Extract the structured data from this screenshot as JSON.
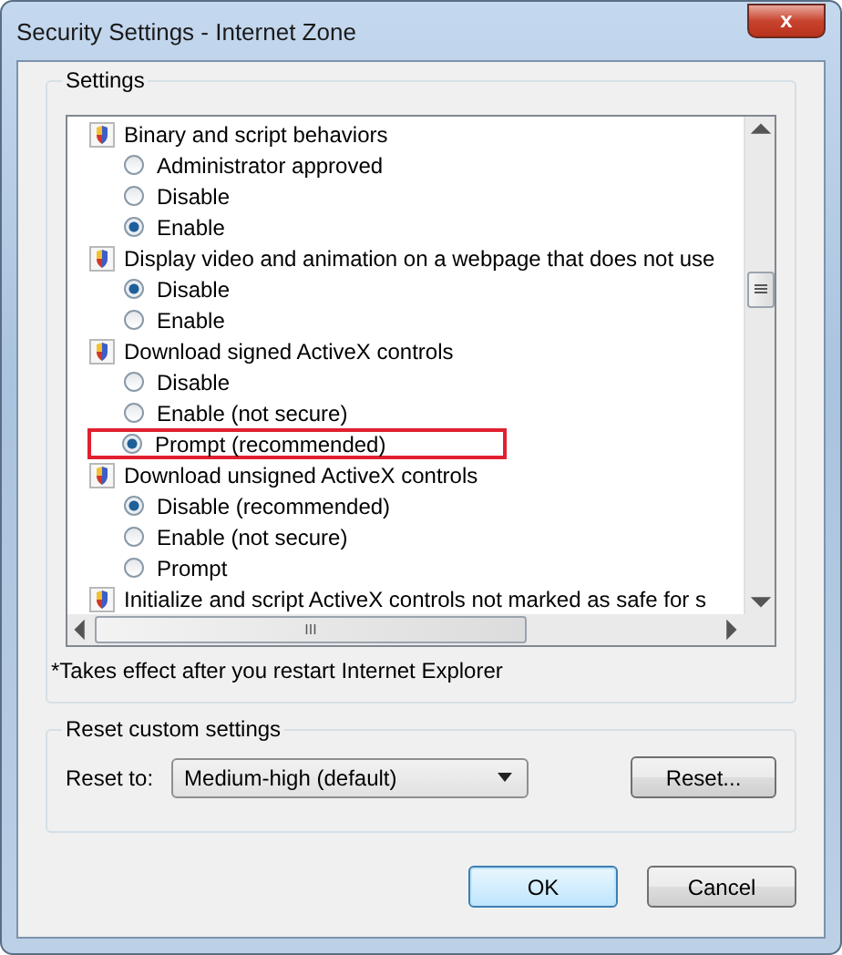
{
  "window": {
    "title": "Security Settings - Internet Zone",
    "close": "x"
  },
  "settings": {
    "label": "Settings",
    "items": [
      {
        "label": "Binary and script behaviors",
        "options": [
          {
            "label": "Administrator approved",
            "selected": false,
            "highlighted": false
          },
          {
            "label": "Disable",
            "selected": false,
            "highlighted": false
          },
          {
            "label": "Enable",
            "selected": true,
            "highlighted": false
          }
        ]
      },
      {
        "label": "Display video and animation on a webpage that does not use",
        "options": [
          {
            "label": "Disable",
            "selected": true,
            "highlighted": false
          },
          {
            "label": "Enable",
            "selected": false,
            "highlighted": false
          }
        ]
      },
      {
        "label": "Download signed ActiveX controls",
        "options": [
          {
            "label": "Disable",
            "selected": false,
            "highlighted": false
          },
          {
            "label": "Enable (not secure)",
            "selected": false,
            "highlighted": false
          },
          {
            "label": "Prompt (recommended)",
            "selected": true,
            "highlighted": true
          }
        ]
      },
      {
        "label": "Download unsigned ActiveX controls",
        "options": [
          {
            "label": "Disable (recommended)",
            "selected": true,
            "highlighted": false
          },
          {
            "label": "Enable (not secure)",
            "selected": false,
            "highlighted": false
          },
          {
            "label": "Prompt",
            "selected": false,
            "highlighted": false
          }
        ]
      },
      {
        "label": "Initialize and script ActiveX controls not marked as safe for s"
      }
    ],
    "scroll_grip": "III"
  },
  "note": "*Takes effect after you restart Internet Explorer",
  "reset": {
    "label": "Reset custom settings",
    "reset_to_label": "Reset to:",
    "dropdown": "Medium-high (default)",
    "button": "Reset..."
  },
  "buttons": [
    {
      "label": "OK",
      "default": true
    },
    {
      "label": "Cancel",
      "default": false
    }
  ]
}
